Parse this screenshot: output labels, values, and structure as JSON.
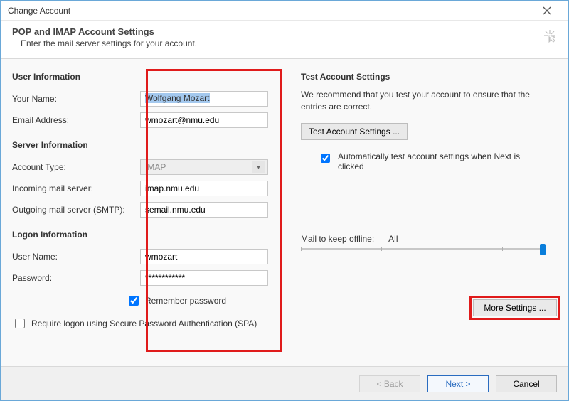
{
  "window": {
    "title": "Change Account"
  },
  "header": {
    "title": "POP and IMAP Account Settings",
    "subtitle": "Enter the mail server settings for your account."
  },
  "sections": {
    "user": "User Information",
    "server": "Server Information",
    "logon": "Logon Information",
    "test": "Test Account Settings"
  },
  "labels": {
    "your_name": "Your Name:",
    "email": "Email Address:",
    "account_type": "Account Type:",
    "incoming": "Incoming mail server:",
    "outgoing": "Outgoing mail server (SMTP):",
    "username": "User Name:",
    "password": "Password:",
    "remember": "Remember password",
    "spa": "Require logon using Secure Password Authentication (SPA)",
    "mail_offline": "Mail to keep offline:"
  },
  "values": {
    "your_name": "Wolfgang Mozart",
    "email": "wmozart@nmu.edu",
    "account_type": "IMAP",
    "incoming": "imap.nmu.edu",
    "outgoing": "semail.nmu.edu",
    "username": "wmozart",
    "password": "************",
    "remember_checked": true,
    "spa_checked": false,
    "auto_test_checked": true,
    "mail_offline_value": "All"
  },
  "test_panel": {
    "blurb": "We recommend that you test your account to ensure that the entries are correct.",
    "button": "Test Account Settings ...",
    "auto_test_label": "Automatically test account settings when Next is clicked"
  },
  "buttons": {
    "more_settings": "More Settings ...",
    "back": "< Back",
    "next": "Next >",
    "cancel": "Cancel"
  }
}
